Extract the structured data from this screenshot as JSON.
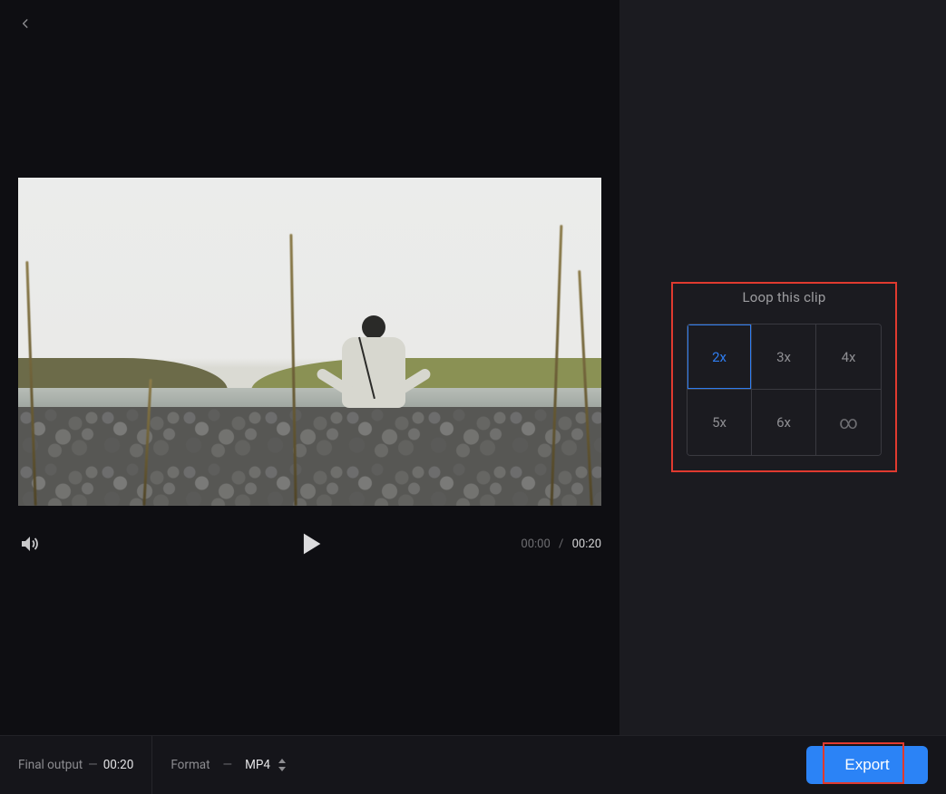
{
  "playback": {
    "current_time": "00:00",
    "separator": "/",
    "duration": "00:20"
  },
  "loop": {
    "title": "Loop this clip",
    "options": [
      {
        "label": "2x",
        "selected": true
      },
      {
        "label": "3x",
        "selected": false
      },
      {
        "label": "4x",
        "selected": false
      },
      {
        "label": "5x",
        "selected": false
      },
      {
        "label": "6x",
        "selected": false
      },
      {
        "label": "∞",
        "selected": false,
        "infinity": true
      }
    ]
  },
  "footer": {
    "final_output_label": "Final output",
    "final_output_value": "00:20",
    "format_label": "Format",
    "format_value": "MP4",
    "dash": "—"
  },
  "export": {
    "label": "Export"
  }
}
